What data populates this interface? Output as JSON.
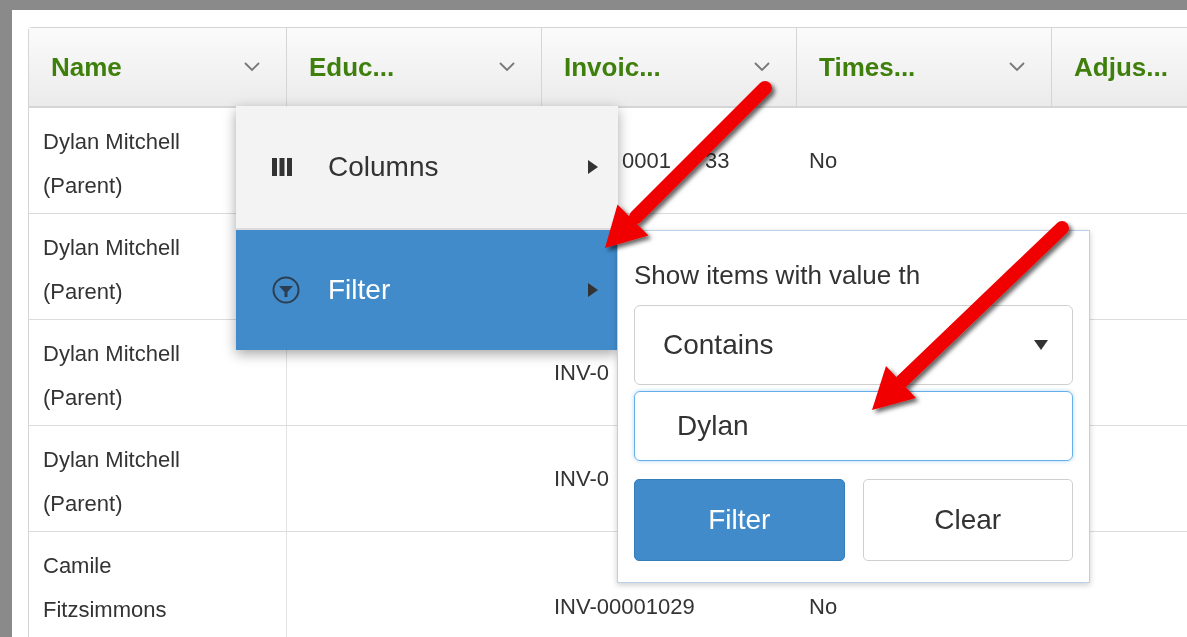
{
  "grid": {
    "columns": [
      {
        "label": "Name",
        "menu_button": true
      },
      {
        "label": "Educ...",
        "menu_button": true
      },
      {
        "label": "Invoic...",
        "menu_button": true
      },
      {
        "label": "Times...",
        "menu_button": true
      },
      {
        "label": "Adjus...",
        "menu_button": false
      }
    ],
    "rows": [
      {
        "name": "Dylan Mitchell (Parent)",
        "invoice_parts": [
          "0001",
          "33"
        ],
        "times": "No"
      },
      {
        "name": "Dylan Mitchell (Parent)"
      },
      {
        "name": "Dylan Mitchell (Parent)",
        "invoice_parts": [
          "INV-0"
        ]
      },
      {
        "name": "Dylan Mitchell (Parent)",
        "invoice_parts": [
          "INV-0"
        ]
      },
      {
        "name": "Camile Fitzsimmons",
        "invoice_parts": [
          "INV-00001029"
        ],
        "times": "No"
      }
    ]
  },
  "column_menu": {
    "items": [
      {
        "kind": "columns",
        "label": "Columns",
        "selected": false
      },
      {
        "kind": "filter",
        "label": "Filter",
        "selected": true
      }
    ]
  },
  "filter_popup": {
    "label": "Show items with value th",
    "operator": "Contains",
    "value": "Dylan",
    "buttons": [
      {
        "kind": "primary",
        "label": "Filter"
      },
      {
        "kind": "default",
        "label": "Clear"
      }
    ]
  }
}
